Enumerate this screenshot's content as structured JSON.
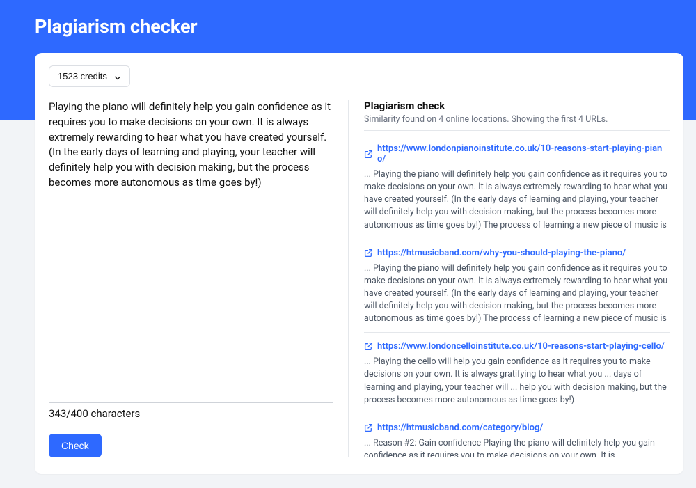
{
  "header": {
    "title": "Plagiarism checker"
  },
  "credits": {
    "label": "1523 credits"
  },
  "input": {
    "text": "Playing the piano will definitely help you gain confidence as it requires you to make decisions on your own. It is always extremely rewarding to hear what you have created yourself. (In the early days of learning and playing, your teacher will definitely help you with decision making, but the process becomes more autonomous as time goes by!)",
    "char_count": "343/400 characters"
  },
  "actions": {
    "check_label": "Check"
  },
  "results": {
    "title": "Plagiarism check",
    "subtitle": "Similarity found on 4 online locations. Showing the first 4 URLs.",
    "items": [
      {
        "url": "https://www.londonpianoinstitute.co.uk/10-reasons-start-playing-piano/",
        "snippet": "... Playing the piano will definitely help you gain confidence as it requires you to make decisions on your own. It is always extremely rewarding to hear what you have created yourself. (In the early days of learning and playing, your teacher will definitely help you with decision making, but the process becomes more autonomous as time goes by!) The process of learning a new piece of music is"
      },
      {
        "url": "https://htmusicband.com/why-you-should-playing-the-piano/",
        "snippet": "... Playing the piano will definitely help you gain confidence as it requires you to make decisions on your own. It is always extremely rewarding to hear what you have created yourself. (In the early days of learning and playing, your teacher will definitely help you with decision making, but the process becomes more autonomous as time goes by!) The process of learning a new piece of music is"
      },
      {
        "url": "https://www.londoncelloinstitute.co.uk/10-reasons-start-playing-cello/",
        "snippet": "... Playing the cello will help you gain confidence as it requires you to make decisions on your own. It is always gratifying to hear what you ... days of learning and playing, your teacher will ... help you with decision making, but the process becomes more autonomous as time goes by!)"
      },
      {
        "url": "https://htmusicband.com/category/blog/",
        "snippet": "... Reason #2: Gain confidence Playing the piano will definitely help you gain confidence as it requires you to make decisions on your own. It is"
      }
    ]
  }
}
